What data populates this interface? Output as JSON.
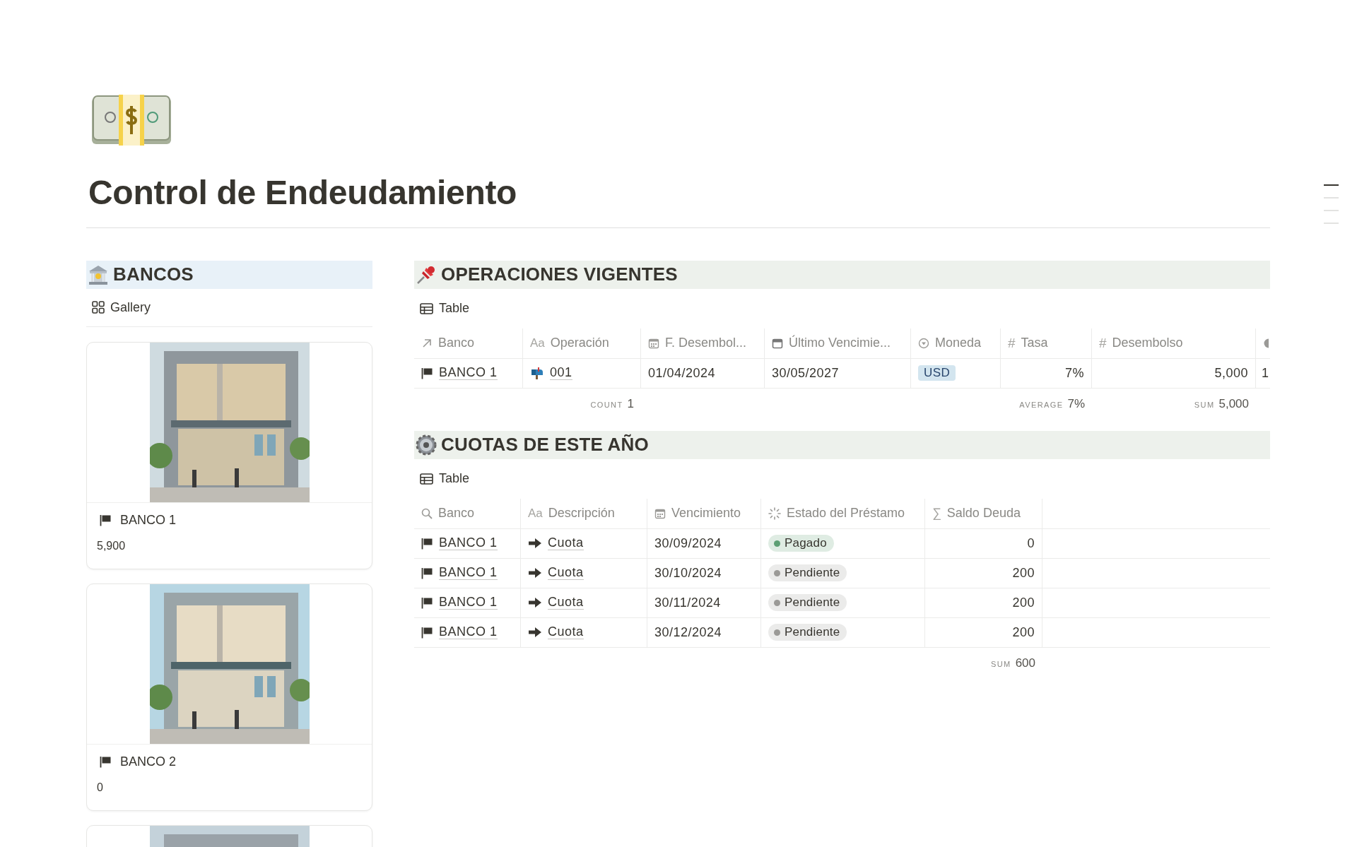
{
  "page": {
    "title": "Control de Endeudamiento"
  },
  "toc": [
    {
      "selected": true
    },
    {
      "selected": false
    },
    {
      "selected": false
    },
    {
      "selected": false
    }
  ],
  "bancos": {
    "title": "BANCOS",
    "view": "Gallery",
    "cards": [
      {
        "image": {
          "kind": "picture"
        },
        "title": "BANCO 1",
        "value": "5,900"
      },
      {
        "image": {
          "kind": "picture"
        },
        "title": "BANCO 2",
        "value": "0"
      },
      {
        "image": {
          "kind": "picture"
        }
      }
    ]
  },
  "operaciones": {
    "title": "OPERACIONES VIGENTES",
    "view": "Table",
    "columns": [
      {
        "kind": "relation",
        "label": "Banco"
      },
      {
        "kind": "title",
        "glyph": "Aa",
        "label": "Operación",
        "aggregate": {
          "label": "COUNT",
          "value": "1"
        }
      },
      {
        "kind": "date",
        "label": "F. Desembol..."
      },
      {
        "kind": "datebold",
        "label": "Último Vencimie..."
      },
      {
        "kind": "select",
        "label": "Moneda"
      },
      {
        "kind": "number",
        "glyph": "#",
        "label": "Tasa",
        "aggregate": {
          "label": "AVERAGE",
          "value": "7%"
        }
      },
      {
        "kind": "number",
        "glyph": "#",
        "label": "Desembolso",
        "aggregate": {
          "label": "SUM",
          "value": "5,000"
        }
      },
      {
        "kind": "formula"
      }
    ],
    "rows": [
      {
        "banco": "BANCO 1",
        "operacion": "001",
        "f_desembolso": "01/04/2024",
        "ultimo_vencimiento": "30/05/2027",
        "moneda": "USD",
        "tasa": "7%",
        "desembolso": "5,000",
        "column_8": "1"
      }
    ]
  },
  "cuotas": {
    "title": "CUOTAS DE ESTE AÑO",
    "view": "Table",
    "columns": [
      {
        "kind": "rollup",
        "label": "Banco"
      },
      {
        "kind": "title",
        "glyph": "Aa",
        "label": "Descripción"
      },
      {
        "kind": "date",
        "label": "Vencimiento"
      },
      {
        "kind": "status",
        "label": "Estado del Préstamo"
      },
      {
        "kind": "sum",
        "glyph": "∑",
        "label": "Saldo Deuda",
        "aggregate": {
          "label": "SUM",
          "value": "600"
        }
      }
    ],
    "rows": [
      {
        "banco": "BANCO 1",
        "descripcion": "Cuota",
        "vencimiento": "30/09/2024",
        "estado": {
          "label": "Pagado",
          "color": "#5d9f74"
        },
        "saldo": "0"
      },
      {
        "banco": "BANCO 1",
        "descripcion": "Cuota",
        "vencimiento": "30/10/2024",
        "estado": {
          "label": "Pendiente",
          "color": "#9b9a97"
        },
        "saldo": "200"
      },
      {
        "banco": "BANCO 1",
        "descripcion": "Cuota",
        "vencimiento": "30/11/2024",
        "estado": {
          "label": "Pendiente",
          "color": "#9b9a97"
        },
        "saldo": "200"
      },
      {
        "banco": "BANCO 1",
        "descripcion": "Cuota",
        "vencimiento": "30/12/2024",
        "estado": {
          "label": "Pendiente",
          "color": "#9b9a97"
        },
        "saldo": "200"
      }
    ]
  }
}
